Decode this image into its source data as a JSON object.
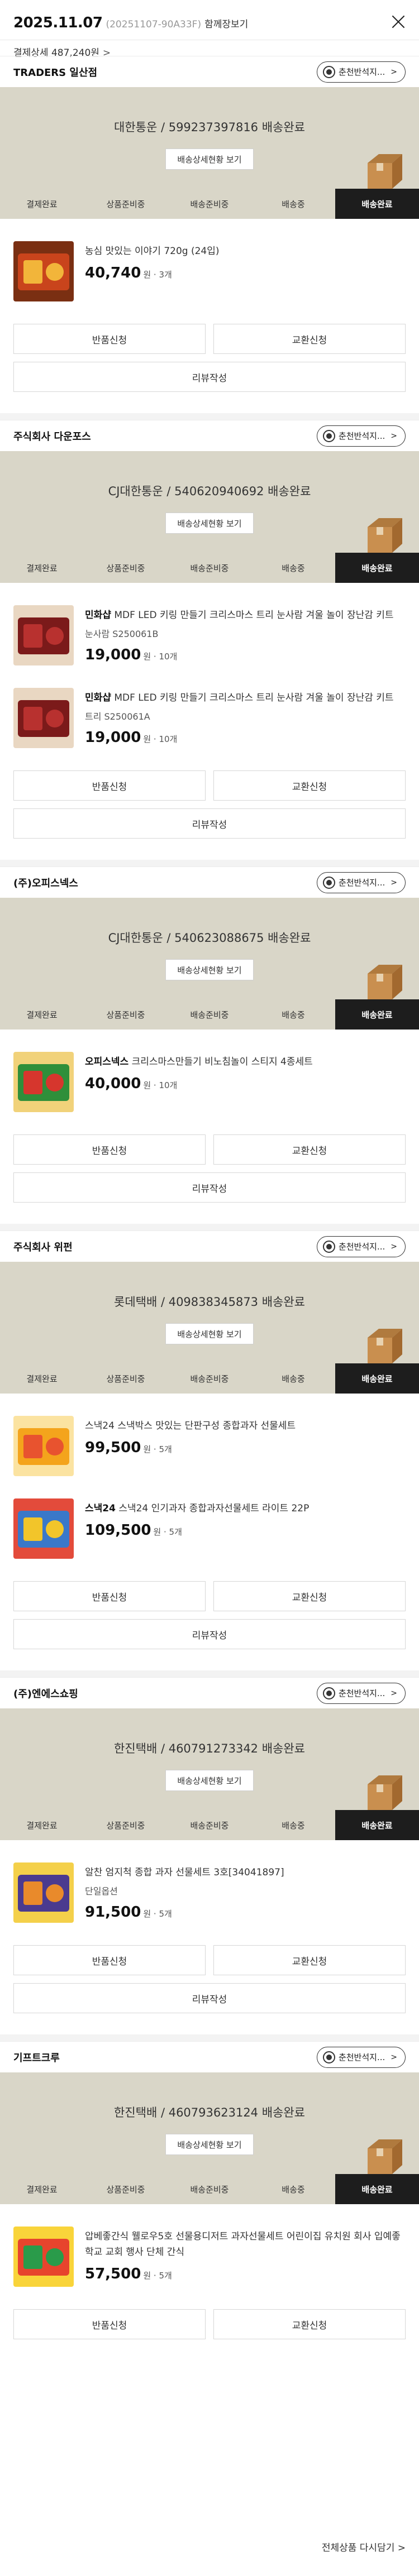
{
  "header": {
    "date": "2025.11.07",
    "order_no": "(20251107-90A33F)",
    "together": "함께장보기",
    "payment": "결제상세 487,240원",
    "payment_chevron": ">"
  },
  "labels": {
    "chat": "춘천반석지...",
    "detail": "배송상세현황 보기",
    "return": "반품신청",
    "exchange": "교환신청",
    "review": "리뷰작성",
    "steps": [
      "결제완료",
      "상품준비중",
      "배송준비중",
      "배송중",
      "배송완료"
    ]
  },
  "sections": [
    {
      "seller": "TRADERS 일산점",
      "courier": "대한통운 / 599237397816 배송완료",
      "items": [
        {
          "brand": "",
          "name": "농심 맛있는 이야기 720g (24입)",
          "opt": "",
          "price": "40,740",
          "unit": "원 · 3개"
        }
      ]
    },
    {
      "seller": "주식회사 다운포스",
      "courier": "CJ대한통운 / 540620940692 배송완료",
      "items": [
        {
          "brand": "민화샵",
          "name": " MDF LED 키링 만들기 크리스마스 트리 눈사람 겨울 놀이 장난감 키트",
          "opt": "눈사람 S250061B",
          "price": "19,000",
          "unit": "원 · 10개"
        },
        {
          "brand": "민화샵",
          "name": " MDF LED 키링 만들기 크리스마스 트리 눈사람 겨울 놀이 장난감 키트",
          "opt": "트리 S250061A",
          "price": "19,000",
          "unit": "원 · 10개"
        }
      ]
    },
    {
      "seller": "(주)오피스넥스",
      "courier": "CJ대한통운 / 540623088675 배송완료",
      "items": [
        {
          "brand": "오피스넥스",
          "name": " 크리스마스만들기 비노침놀이 스티지 4종세트",
          "opt": "",
          "price": "40,000",
          "unit": "원 · 10개"
        }
      ]
    },
    {
      "seller": "주식회사 위펀",
      "courier": "롯데택배 / 409838345873 배송완료",
      "items": [
        {
          "brand": "",
          "name": "스낵24 스낵박스 맛있는 단판구성 종합과자 선물세트",
          "opt": "",
          "price": "99,500",
          "unit": "원 · 5개"
        },
        {
          "brand": "스낵24",
          "name": " 스낵24 인기과자 종합과자선물세트 라이트 22P",
          "opt": "",
          "price": "109,500",
          "unit": "원 · 5개"
        }
      ]
    },
    {
      "seller": "(주)엔에스쇼핑",
      "courier": "한진택배 / 460791273342 배송완료",
      "items": [
        {
          "brand": "",
          "name": "알찬 엄지척 종합 과자 선물세트 3호[34041897]",
          "opt": "단일옵션",
          "price": "91,500",
          "unit": "원 · 5개"
        }
      ]
    },
    {
      "seller": "기프트크루",
      "courier": "한진택배 / 460793623124 배송완료",
      "items": [
        {
          "brand": "",
          "name": "압베좋간식 웰로우5호 선물용디저트 과자선물세트 어린이집 유치원 회사 입예좋 학교 교회 행사 단체 간식",
          "opt": "",
          "price": "57,500",
          "unit": "원 · 5개"
        }
      ]
    }
  ],
  "footer": {
    "reorder": "전체상품 다시담기 >"
  },
  "colors": {
    "track_bg": "#d9d6c8",
    "active_step": "#1d1d1d"
  }
}
